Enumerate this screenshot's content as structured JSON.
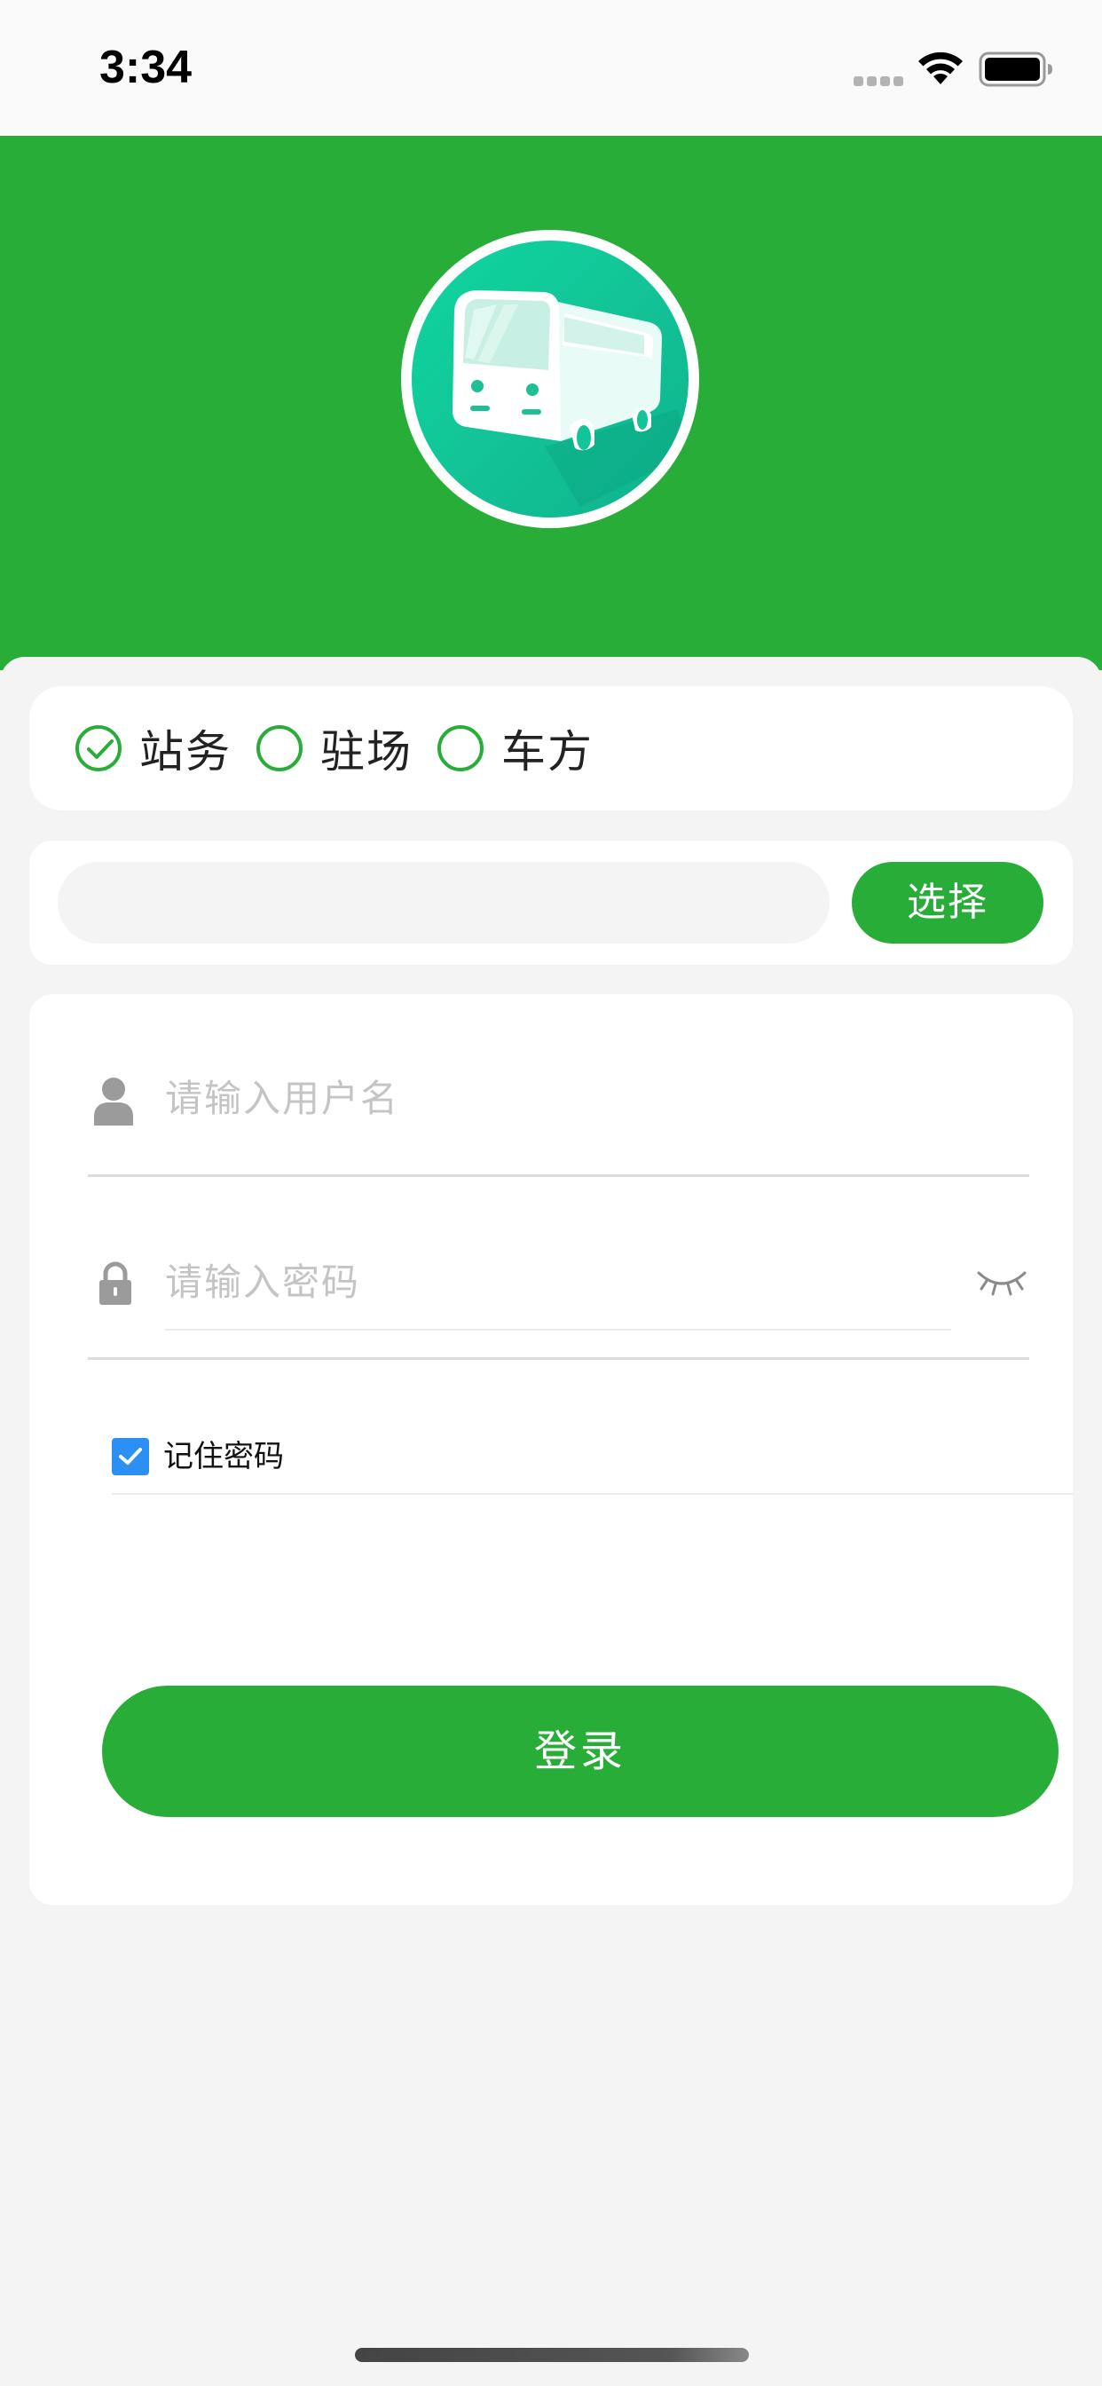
{
  "status_bar": {
    "time": "3:34",
    "icons": [
      "signal-dots-icon",
      "wifi-icon",
      "battery-icon"
    ]
  },
  "header": {
    "logo_icon": "bus-icon",
    "background_color": "#27ad38"
  },
  "roles": {
    "selected": "站务",
    "options": [
      {
        "label": "站务",
        "checked": true
      },
      {
        "label": "驻场",
        "checked": false
      },
      {
        "label": "车方",
        "checked": false
      }
    ]
  },
  "station_select": {
    "value": "",
    "button_label": "选择"
  },
  "login_form": {
    "username_placeholder": "请输入用户名",
    "username_icon": "user-icon",
    "password_placeholder": "请输入密码",
    "password_icon": "lock-icon",
    "visibility_icon": "eye-closed-icon",
    "remember_label": "记住密码",
    "remember_checked": true,
    "login_label": "登录"
  },
  "colors": {
    "accent": "#27ad38",
    "checkbox": "#2b8ff3",
    "background": "#f4f4f4",
    "placeholder": "#c4c4c4"
  }
}
